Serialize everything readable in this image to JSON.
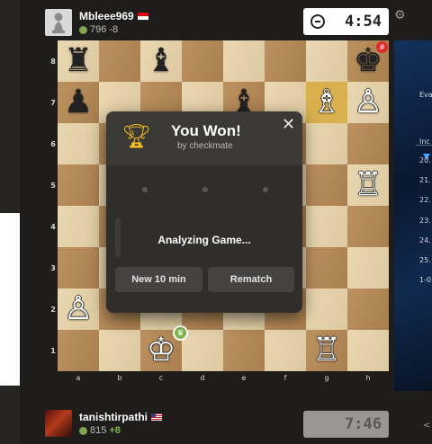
{
  "top_player": {
    "name": "Mbleee969",
    "rating": "796",
    "rating_change": "-8",
    "flag": "indonesia",
    "avatar": "pawn-avatar"
  },
  "bottom_player": {
    "name": "tanishtirpathi",
    "rating": "815",
    "rating_change": "+8",
    "flag": "usa"
  },
  "clocks": {
    "top": "4:54",
    "bottom": "7:46"
  },
  "board": {
    "ranks": [
      "8",
      "7",
      "6",
      "5",
      "4",
      "3",
      "2",
      "1"
    ],
    "files": [
      "a",
      "b",
      "c",
      "d",
      "e",
      "f",
      "g",
      "h"
    ],
    "pieces": [
      {
        "square": "a8",
        "glyph": "♜",
        "color": "b"
      },
      {
        "square": "c8",
        "glyph": "♝",
        "color": "b"
      },
      {
        "square": "h8",
        "glyph": "♚",
        "color": "b"
      },
      {
        "square": "a7",
        "glyph": "♟",
        "color": "b"
      },
      {
        "square": "e7",
        "glyph": "♝",
        "color": "b"
      },
      {
        "square": "g7",
        "glyph": "♗",
        "color": "w"
      },
      {
        "square": "h7",
        "glyph": "♙",
        "color": "w"
      },
      {
        "square": "h5",
        "glyph": "♖",
        "color": "w"
      },
      {
        "square": "a2",
        "glyph": "♙",
        "color": "w"
      },
      {
        "square": "c1",
        "glyph": "♔",
        "color": "w"
      },
      {
        "square": "g1",
        "glyph": "♖",
        "color": "w"
      }
    ],
    "highlights": [
      "g7"
    ],
    "light_color": "#e8d4aa",
    "dark_color": "#b88a56"
  },
  "result_modal": {
    "icon": "trophy-icon",
    "title": "You Won!",
    "subtitle": "by checkmate",
    "status": "Analyzing Game...",
    "new_game_label": "New 10 min",
    "rematch_label": "Rematch",
    "close_icon": "close-icon"
  },
  "side_panel_fragments": [
    "Eva",
    "Inc",
    "20.",
    "21.",
    "22.",
    "23.",
    "24.",
    "25.",
    "1-0"
  ],
  "colors": {
    "win_green": "#81b64c",
    "loss_red": "#e02828",
    "trophy_gold": "#f5c01c"
  }
}
